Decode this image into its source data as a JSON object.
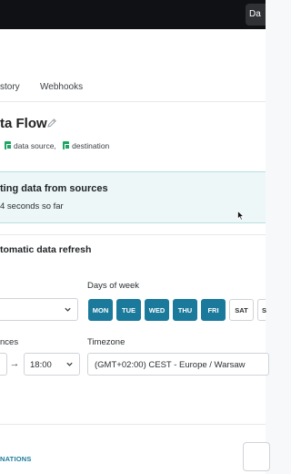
{
  "topbar": {
    "button_label": "Da"
  },
  "tabs": [
    {
      "label": "story"
    },
    {
      "label": "Webhooks"
    }
  ],
  "flow": {
    "title": "ta Flow",
    "sources": [
      {
        "label": "data source,"
      },
      {
        "label": "destination"
      }
    ]
  },
  "status": {
    "title": "ting data from sources",
    "subtitle": "4 seconds so far"
  },
  "refresh": {
    "title": "tomatic data refresh",
    "frequency_value": "",
    "days_label": "Days of week",
    "days": [
      {
        "label": "MON",
        "selected": true
      },
      {
        "label": "TUE",
        "selected": true
      },
      {
        "label": "WED",
        "selected": true
      },
      {
        "label": "THU",
        "selected": true
      },
      {
        "label": "FRI",
        "selected": true
      },
      {
        "label": "SAT",
        "selected": false
      },
      {
        "label": "S",
        "selected": false
      }
    ],
    "sync_label": "nces",
    "from_value": "",
    "to_value": "18:00",
    "timezone_label": "Timezone",
    "timezone_value": "(GMT+02:00) CEST - Europe / Warsaw"
  },
  "footer": {
    "link_label": "NATIONS"
  },
  "colors": {
    "accent": "#1b7a9c",
    "status_bg": "#edf7f8",
    "topbar": "#0f1114"
  }
}
